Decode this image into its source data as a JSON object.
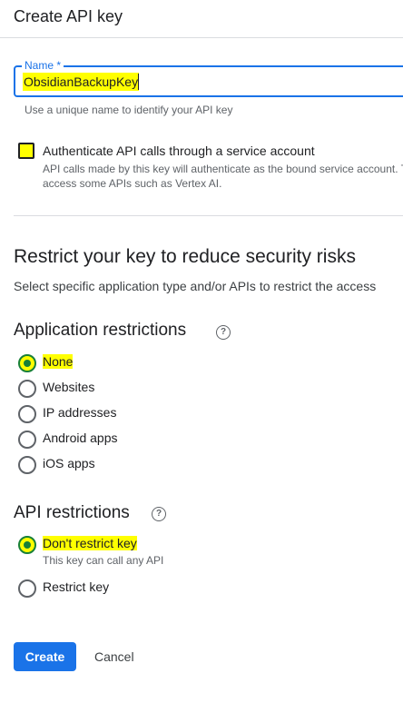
{
  "header": {
    "title": "Create API key"
  },
  "name_field": {
    "label": "Name *",
    "value": "ObsidianBackupKey",
    "helper": "Use a unique name to identify your API key"
  },
  "service_account": {
    "title": "Authenticate API calls through a service account",
    "description": "API calls made by this key will authenticate as the bound service account. To access some APIs such as Vertex AI.",
    "checked": false
  },
  "restrict": {
    "title": "Restrict your key to reduce security risks",
    "subtitle": "Select specific application type and/or APIs to restrict the access"
  },
  "app_restrictions": {
    "title": "Application restrictions",
    "options": [
      {
        "label": "None",
        "checked": true
      },
      {
        "label": "Websites",
        "checked": false
      },
      {
        "label": "IP addresses",
        "checked": false
      },
      {
        "label": "Android apps",
        "checked": false
      },
      {
        "label": "iOS apps",
        "checked": false
      }
    ]
  },
  "api_restrictions": {
    "title": "API restrictions",
    "options": [
      {
        "label": "Don't restrict key",
        "sublabel": "This key can call any API",
        "checked": true
      },
      {
        "label": "Restrict key",
        "checked": false
      }
    ]
  },
  "actions": {
    "create": "Create",
    "cancel": "Cancel"
  },
  "colors": {
    "accent": "#1a73e8",
    "radio_selected": "#188038",
    "highlight": "#ffff00"
  }
}
